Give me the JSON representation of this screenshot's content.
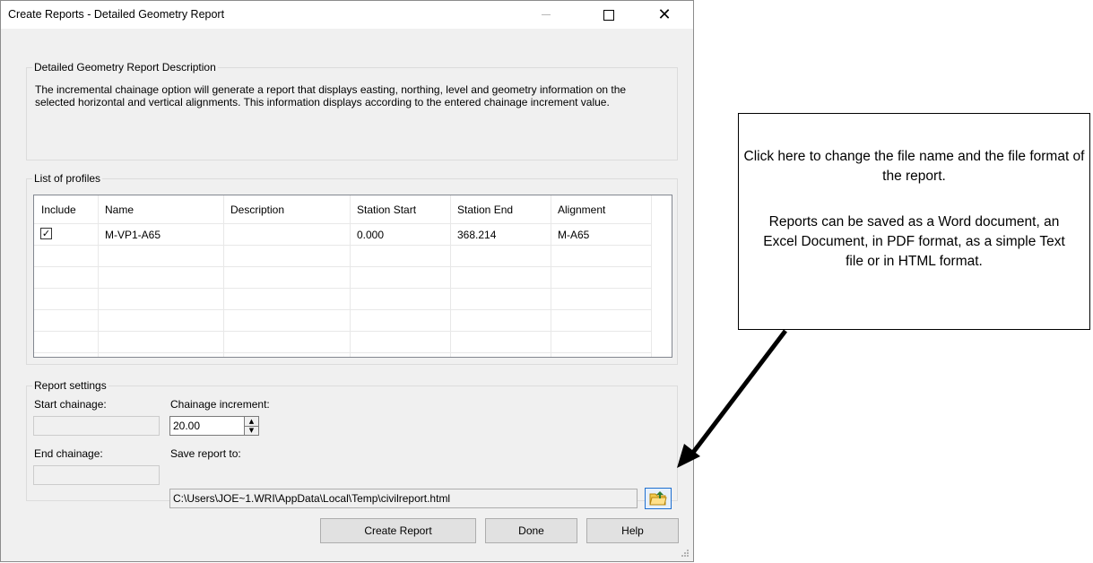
{
  "window": {
    "title": "Create Reports -  Detailed Geometry Report"
  },
  "description_group": {
    "legend": "Detailed Geometry Report Description",
    "text": "The incremental chainage option will generate a report that displays easting, northing, level and geometry information on the selected horizontal and vertical alignments. This information displays according to the entered chainage increment value."
  },
  "profiles_group": {
    "legend": "List of profiles",
    "columns": [
      "Include",
      "Name",
      "Description",
      "Station Start",
      "Station End",
      "Alignment"
    ],
    "rows": [
      {
        "include": true,
        "name": "M-VP1-A65",
        "description": "",
        "station_start": "0.000",
        "station_end": "368.214",
        "alignment": "M-A65"
      }
    ]
  },
  "report_settings": {
    "legend": "Report settings",
    "start_chainage_label": "Start chainage:",
    "start_chainage_value": "",
    "chainage_increment_label": "Chainage increment:",
    "chainage_increment_value": "20.00",
    "end_chainage_label": "End chainage:",
    "end_chainage_value": "",
    "save_to_label": "Save report to:",
    "save_to_value": "C:\\Users\\JOE~1.WRI\\AppData\\Local\\Temp\\civilreport.html"
  },
  "buttons": {
    "create_report": "Create Report",
    "done": "Done",
    "help": "Help"
  },
  "callout": {
    "line1": "Click here to change the file name and the file format of the report.",
    "line2": "Reports can be saved as a Word document, an Excel Document, in PDF format, as a simple Text file or in HTML format."
  },
  "icons": {
    "browse": "folder-browse-icon",
    "checkbox": "checkbox-checked-icon"
  },
  "colors": {
    "dialog_bg": "#f0f0f0",
    "accent_border": "#1e6fd0"
  }
}
